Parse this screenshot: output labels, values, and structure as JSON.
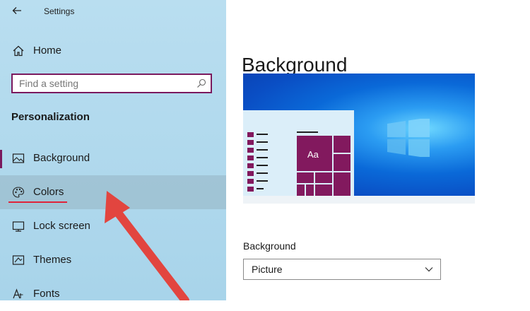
{
  "window": {
    "title": "Settings"
  },
  "sidebar": {
    "home_label": "Home",
    "search_placeholder": "Find a setting",
    "section_title": "Personalization",
    "items": [
      {
        "label": "Background",
        "icon": "image-icon"
      },
      {
        "label": "Colors",
        "icon": "palette-icon"
      },
      {
        "label": "Lock screen",
        "icon": "lock-screen-icon"
      },
      {
        "label": "Themes",
        "icon": "themes-icon"
      },
      {
        "label": "Fonts",
        "icon": "fonts-icon"
      }
    ]
  },
  "main": {
    "title": "Background",
    "preview_tile_label": "Aa",
    "background_field": {
      "label": "Background",
      "value": "Picture"
    }
  },
  "colors": {
    "accent": "#7a1a5e",
    "annotation_red": "#e0233a",
    "sidebar_bg": "#b9def0"
  }
}
